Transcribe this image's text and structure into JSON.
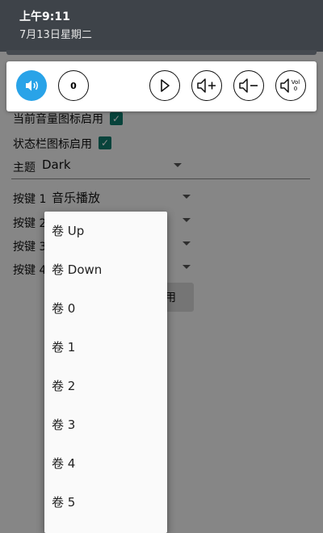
{
  "status": {
    "time": "上午9:11",
    "date": "7月13日星期二"
  },
  "toolbar": {
    "buttons": [
      {
        "icon": "speaker-icon",
        "active": true
      },
      {
        "icon": "number-icon",
        "label": "0"
      },
      {
        "icon": "play-icon"
      },
      {
        "icon": "volume-up-icon"
      },
      {
        "icon": "volume-down-icon"
      },
      {
        "icon": "volume-zero-icon",
        "label_top": "Vol",
        "label_bottom": "0"
      }
    ],
    "accent": "#29a3e8"
  },
  "settings": {
    "current_icon_enabled": "当前音量图标启用",
    "statusbar_icon_enabled": "状态栏图标启用",
    "theme_label": "主题",
    "theme_value": "Dark",
    "key1_label": "按键 1",
    "key1_value": "音乐播放",
    "key2_label": "按键 2",
    "key3_label": "按键 3",
    "key4_label": "按键 4",
    "button_partial": "用",
    "check_color": "#0f7a6c"
  },
  "dropdown": {
    "options": [
      "卷 Up",
      "卷 Down",
      "卷 0",
      "卷 1",
      "卷 2",
      "卷 3",
      "卷 4",
      "卷 5"
    ]
  }
}
